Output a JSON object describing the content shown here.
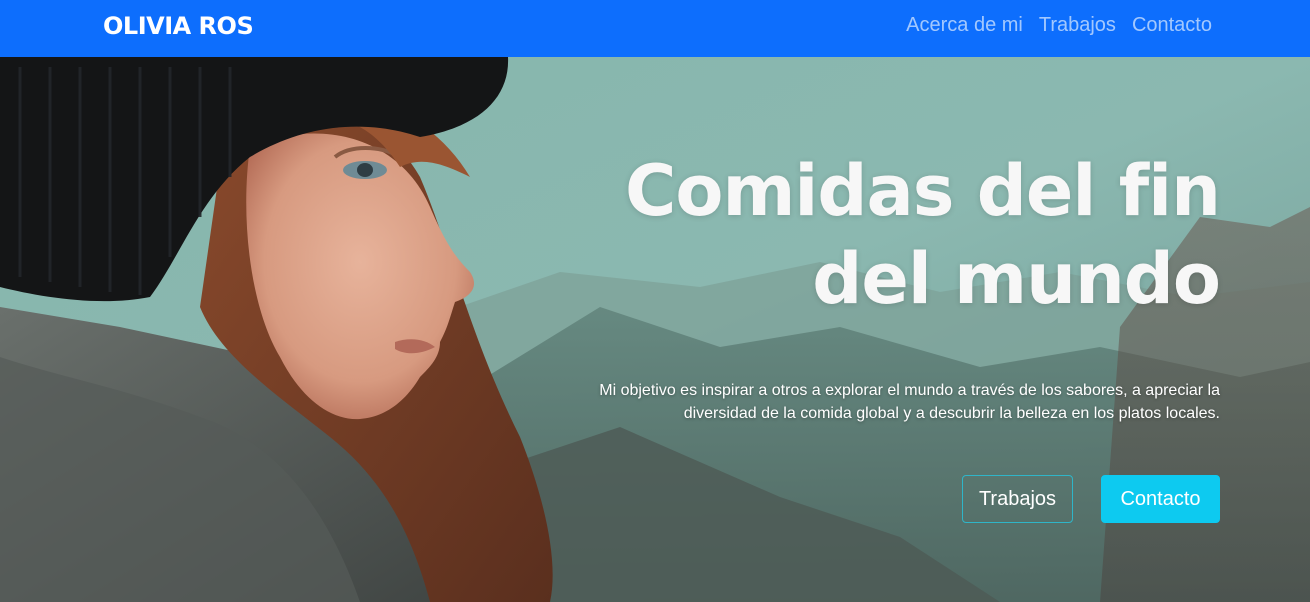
{
  "navbar": {
    "brand": "OLIVIA ROS",
    "links": [
      "Acerca de mi",
      "Trabajos",
      "Contacto"
    ],
    "background": "#0d6efd"
  },
  "hero": {
    "title": "Comidas del fin del mundo",
    "description": "Mi objetivo es inspirar a otros a explorar el mundo a través de los sabores, a apreciar la diversidad de la comida global y a descubrir la belleza en los platos locales.",
    "buttons": {
      "primary_outline": "Trabajos",
      "secondary_solid": "Contacto"
    },
    "accent_color": "#0dcaf0"
  },
  "icons": {
    "hero_image": "woman-portrait-photo"
  }
}
